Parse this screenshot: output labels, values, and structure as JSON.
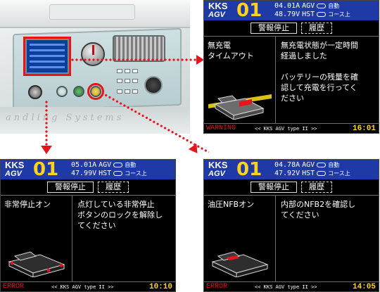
{
  "photo": {
    "footer_text": "andling  Systems"
  },
  "colors": {
    "header_bg": "#1f3aa6",
    "accent_number": "#ffd21e",
    "status_red": "#e8141c",
    "callout_red": "#e8141c"
  },
  "panels": {
    "top_right": {
      "brand": "KKS",
      "agv": "AGV",
      "number": "01",
      "current": "04.01A",
      "voltage": "48.79V",
      "agv_label": "AGV",
      "hst_label": "HST",
      "mode1": "自動",
      "mode2": "コース上",
      "tab1": "警報停止",
      "tab2": "履歴",
      "title": "無充電\nタイムアウト",
      "message": "無充電状態が一定時間\n経過しました\n\nバッテリーの残量を確\n認して充電を行ってく\nださい",
      "status": "WARNING",
      "version": "<< KKS AGV type II >>",
      "time": "16:01"
    },
    "bottom_left": {
      "brand": "KKS",
      "agv": "AGV",
      "number": "01",
      "current": "05.01A",
      "voltage": "47.99V",
      "agv_label": "AGV",
      "hst_label": "HST",
      "mode1": "自動",
      "mode2": "コース上",
      "tab1": "警報停止",
      "tab2": "履歴",
      "title": "非常停止オン",
      "message": "点灯している非常停止\nボタンのロックを解除し\nてください",
      "status": "ERROR",
      "version": "<< KKS AGV type II >>",
      "time": "10:10"
    },
    "bottom_right": {
      "brand": "KKS",
      "agv": "AGV",
      "number": "01",
      "current": "04.78A",
      "voltage": "47.92V",
      "agv_label": "AGV",
      "hst_label": "HST",
      "mode1": "自動",
      "mode2": "コース上",
      "tab1": "警報停止",
      "tab2": "履歴",
      "title": "油圧NFBオン",
      "message": "内部のNFB2を確認し\nてください",
      "status": "ERROR",
      "version": "<< KKS AGV type II >>",
      "time": "14:05"
    }
  }
}
